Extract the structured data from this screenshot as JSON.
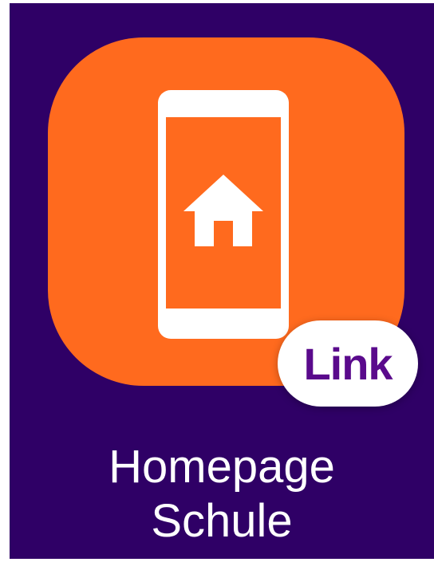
{
  "colors": {
    "background": "#2f0066",
    "icon": "#ff6a1e",
    "badge_text": "#5a0a8c",
    "caption_text": "#ffffff"
  },
  "icon": {
    "name": "phone-home-icon"
  },
  "badge": {
    "label": "Link"
  },
  "caption": {
    "line1": "Homepage",
    "line2": "Schule"
  }
}
